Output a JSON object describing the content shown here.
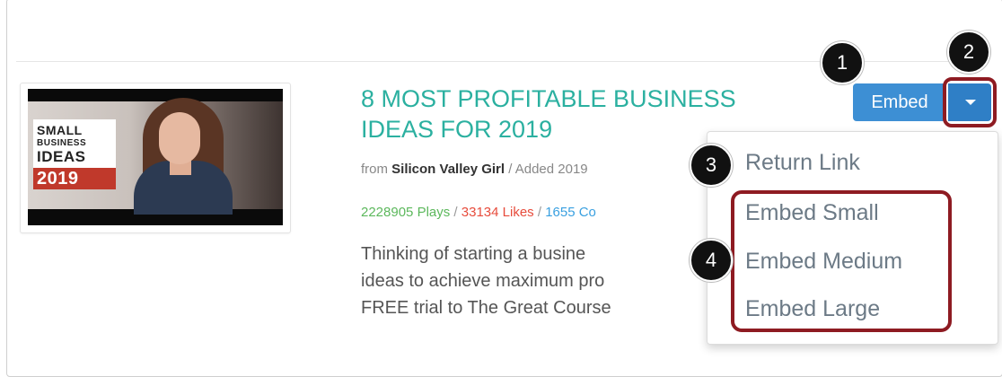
{
  "video": {
    "title": "8 MOST PROFITABLE BUSINESS IDEAS FOR 2019",
    "from_prefix": "from ",
    "author": "Silicon Valley Girl",
    "added": " / Added 2019",
    "plays": "2228905 Plays",
    "likes": "33134 Likes",
    "comments": "1655 Co",
    "separator": " / ",
    "description_lines": [
      "Thinking of starting a busine",
      "ideas to achieve maximum pro",
      "FREE trial to The Great Course"
    ],
    "thumbnail_text": {
      "line1": "SMALL",
      "line2": "BUSINESS",
      "line3": "IDEAS",
      "line4": "2019"
    }
  },
  "embed": {
    "button_label": "Embed",
    "caret_icon": "caret-down-icon"
  },
  "menu": {
    "items": [
      "Return Link",
      "Embed Small",
      "Embed Medium",
      "Embed Large"
    ]
  },
  "callouts": [
    "1",
    "2",
    "3",
    "4"
  ],
  "colors": {
    "title": "#2bb0a0",
    "plays": "#5cb85c",
    "likes": "#e74c3c",
    "comments": "#3aa0e0",
    "embed_button": "#3d8fd4",
    "highlight": "#8e1b22"
  }
}
